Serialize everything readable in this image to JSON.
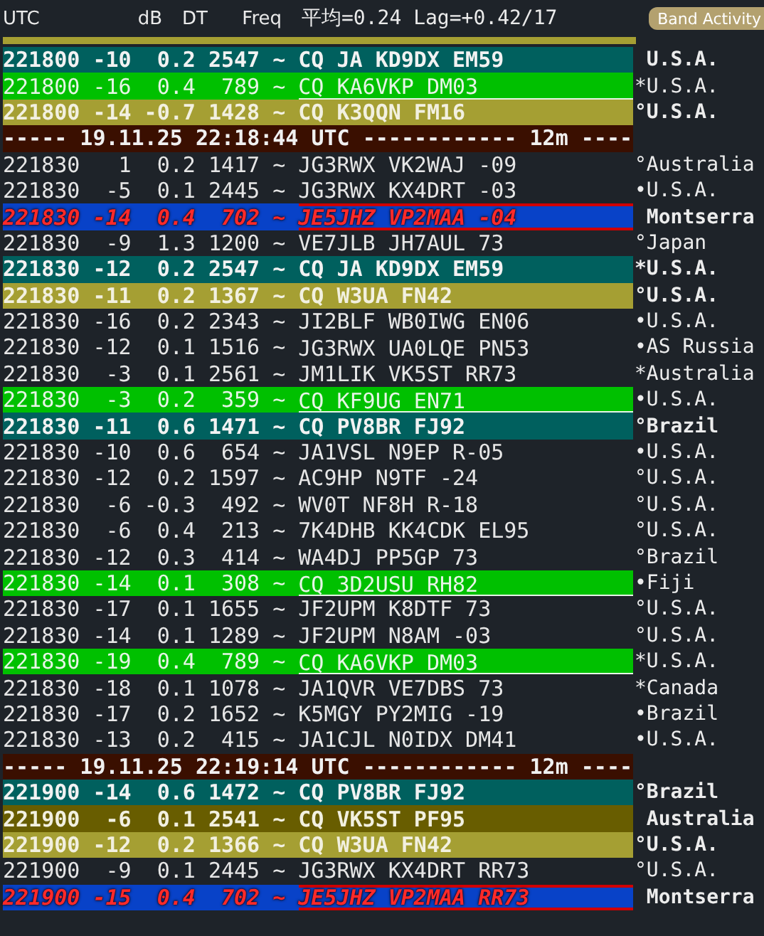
{
  "header": {
    "columns": [
      "UTC",
      "dB",
      "DT",
      "Freq"
    ],
    "stats": "平均=0.24 Lag=+0.42/17",
    "panel_button": "Band Activity"
  },
  "rows": [
    {
      "kind": "teal",
      "utc": "221800",
      "db": "-10",
      "dt": "0.2",
      "freq": "2547",
      "mode": "~",
      "message": "CQ JA KD9DX EM59",
      "country": " U.S.A."
    },
    {
      "kind": "green",
      "utc": "221800",
      "db": "-16",
      "dt": "0.4",
      "freq": "789",
      "mode": "~",
      "message": "CQ KA6VKP DM03",
      "country": "*U.S.A."
    },
    {
      "kind": "olive",
      "utc": "221800",
      "db": "-14",
      "dt": "-0.7",
      "freq": "1428",
      "mode": "~",
      "message": "CQ K3QQN FM16",
      "country": "°U.S.A."
    },
    {
      "kind": "separator",
      "text": "----- 19.11.25 22:18:44 UTC ------------ 12m ----"
    },
    {
      "kind": "plain",
      "utc": "221830",
      "db": "1",
      "dt": "0.2",
      "freq": "1417",
      "mode": "~",
      "message": "JG3RWX VK2WAJ -09",
      "country": "°Australia"
    },
    {
      "kind": "plain",
      "utc": "221830",
      "db": "-5",
      "dt": "0.1",
      "freq": "2445",
      "mode": "~",
      "message": "JG3RWX KX4DRT -03",
      "country": "•U.S.A."
    },
    {
      "kind": "blue",
      "utc": "221830",
      "db": "-14",
      "dt": "0.4",
      "freq": "702",
      "mode": "~",
      "message": "JE5JHZ VP2MAA -04",
      "country": " Montserra"
    },
    {
      "kind": "plain",
      "utc": "221830",
      "db": "-9",
      "dt": "1.3",
      "freq": "1200",
      "mode": "~",
      "message": "VE7JLB JH7AUL 73",
      "country": "°Japan"
    },
    {
      "kind": "teal",
      "utc": "221830",
      "db": "-12",
      "dt": "0.2",
      "freq": "2547",
      "mode": "~",
      "message": "CQ JA KD9DX EM59",
      "country": "*U.S.A."
    },
    {
      "kind": "olive",
      "utc": "221830",
      "db": "-11",
      "dt": "0.2",
      "freq": "1367",
      "mode": "~",
      "message": "CQ W3UA FN42",
      "country": "°U.S.A."
    },
    {
      "kind": "plain",
      "utc": "221830",
      "db": "-16",
      "dt": "0.2",
      "freq": "2343",
      "mode": "~",
      "message": "JI2BLF WB0IWG EN06",
      "country": "•U.S.A."
    },
    {
      "kind": "plain",
      "utc": "221830",
      "db": "-12",
      "dt": "0.1",
      "freq": "1516",
      "mode": "~",
      "message": "JG3RWX UA0LQE PN53",
      "country": "•AS Russia"
    },
    {
      "kind": "plain",
      "utc": "221830",
      "db": "-3",
      "dt": "0.1",
      "freq": "2561",
      "mode": "~",
      "message": "JM1LIK VK5ST RR73",
      "country": "*Australia"
    },
    {
      "kind": "green",
      "utc": "221830",
      "db": "-3",
      "dt": "0.2",
      "freq": "359",
      "mode": "~",
      "message": "CQ KF9UG EN71",
      "country": "•U.S.A."
    },
    {
      "kind": "teal",
      "utc": "221830",
      "db": "-11",
      "dt": "0.6",
      "freq": "1471",
      "mode": "~",
      "message": "CQ PV8BR FJ92",
      "country": "°Brazil"
    },
    {
      "kind": "plain",
      "utc": "221830",
      "db": "-10",
      "dt": "0.6",
      "freq": "654",
      "mode": "~",
      "message": "JA1VSL N9EP R-05",
      "country": "•U.S.A."
    },
    {
      "kind": "plain",
      "utc": "221830",
      "db": "-12",
      "dt": "0.2",
      "freq": "1597",
      "mode": "~",
      "message": "AC9HP N9TF -24",
      "country": "°U.S.A."
    },
    {
      "kind": "plain",
      "utc": "221830",
      "db": "-6",
      "dt": "-0.3",
      "freq": "492",
      "mode": "~",
      "message": "WV0T NF8H R-18",
      "country": "°U.S.A."
    },
    {
      "kind": "plain",
      "utc": "221830",
      "db": "-6",
      "dt": "0.4",
      "freq": "213",
      "mode": "~",
      "message": "7K4DHB KK4CDK EL95",
      "country": "°U.S.A."
    },
    {
      "kind": "plain",
      "utc": "221830",
      "db": "-12",
      "dt": "0.3",
      "freq": "414",
      "mode": "~",
      "message": "WA4DJ PP5GP 73",
      "country": "°Brazil"
    },
    {
      "kind": "green",
      "utc": "221830",
      "db": "-14",
      "dt": "0.1",
      "freq": "308",
      "mode": "~",
      "message": "CQ 3D2USU RH82",
      "country": "•Fiji"
    },
    {
      "kind": "plain",
      "utc": "221830",
      "db": "-17",
      "dt": "0.1",
      "freq": "1655",
      "mode": "~",
      "message": "JF2UPM K8DTF 73",
      "country": "°U.S.A."
    },
    {
      "kind": "plain",
      "utc": "221830",
      "db": "-14",
      "dt": "0.1",
      "freq": "1289",
      "mode": "~",
      "message": "JF2UPM N8AM -03",
      "country": "°U.S.A."
    },
    {
      "kind": "green",
      "utc": "221830",
      "db": "-19",
      "dt": "0.4",
      "freq": "789",
      "mode": "~",
      "message": "CQ KA6VKP DM03",
      "country": "*U.S.A."
    },
    {
      "kind": "plain",
      "utc": "221830",
      "db": "-18",
      "dt": "0.1",
      "freq": "1078",
      "mode": "~",
      "message": "JA1QVR VE7DBS 73",
      "country": "*Canada"
    },
    {
      "kind": "plain",
      "utc": "221830",
      "db": "-17",
      "dt": "0.2",
      "freq": "1652",
      "mode": "~",
      "message": "K5MGY PY2MIG -19",
      "country": "•Brazil"
    },
    {
      "kind": "plain",
      "utc": "221830",
      "db": "-13",
      "dt": "0.2",
      "freq": "415",
      "mode": "~",
      "message": "JA1CJL N0IDX DM41",
      "country": "•U.S.A."
    },
    {
      "kind": "separator",
      "text": "----- 19.11.25 22:19:14 UTC ------------ 12m ----"
    },
    {
      "kind": "teal",
      "utc": "221900",
      "db": "-14",
      "dt": "0.6",
      "freq": "1472",
      "mode": "~",
      "message": "CQ PV8BR FJ92",
      "country": "°Brazil"
    },
    {
      "kind": "darkolive",
      "utc": "221900",
      "db": "-6",
      "dt": "0.1",
      "freq": "2541",
      "mode": "~",
      "message": "CQ VK5ST PF95",
      "country": " Australia"
    },
    {
      "kind": "olive",
      "utc": "221900",
      "db": "-12",
      "dt": "0.2",
      "freq": "1366",
      "mode": "~",
      "message": "CQ W3UA FN42",
      "country": "°U.S.A."
    },
    {
      "kind": "plain",
      "utc": "221900",
      "db": "-9",
      "dt": "0.1",
      "freq": "2445",
      "mode": "~",
      "message": "JG3RWX KX4DRT RR73",
      "country": "°U.S.A."
    },
    {
      "kind": "blue",
      "utc": "221900",
      "db": "-15",
      "dt": "0.4",
      "freq": "702",
      "mode": "~",
      "message": "JE5JHZ VP2MAA RR73",
      "country": " Montserra"
    }
  ]
}
